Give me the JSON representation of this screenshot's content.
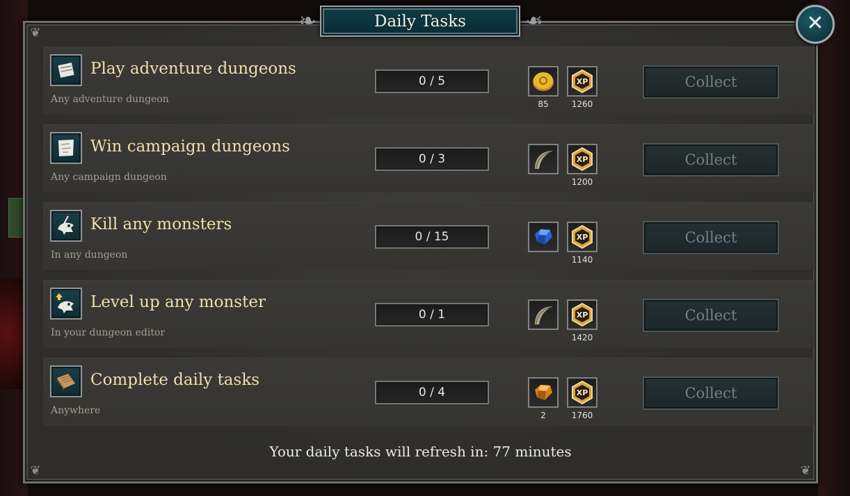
{
  "window": {
    "title": "Daily Tasks"
  },
  "tasks": [
    {
      "title": "Play adventure dungeons",
      "subtitle": "Any adventure dungeon",
      "progress": "0 / 5",
      "reward1": {
        "icon": "gold-coin-icon",
        "amount": "85"
      },
      "reward2": {
        "icon": "xp-icon",
        "amount": "1260"
      },
      "collect_label": "Collect"
    },
    {
      "title": "Win campaign dungeons",
      "subtitle": "Any campaign dungeon",
      "progress": "0 / 3",
      "reward1": {
        "icon": "horn-icon",
        "amount": ""
      },
      "reward2": {
        "icon": "xp-icon",
        "amount": "1200"
      },
      "collect_label": "Collect"
    },
    {
      "title": "Kill any monsters",
      "subtitle": "In any dungeon",
      "progress": "0 / 15",
      "reward1": {
        "icon": "blue-gem-icon",
        "amount": ""
      },
      "reward2": {
        "icon": "xp-icon",
        "amount": "1140"
      },
      "collect_label": "Collect"
    },
    {
      "title": "Level up any monster",
      "subtitle": "In your dungeon editor",
      "progress": "0 / 1",
      "reward1": {
        "icon": "horn-icon",
        "amount": ""
      },
      "reward2": {
        "icon": "xp-icon",
        "amount": "1420"
      },
      "collect_label": "Collect"
    },
    {
      "title": "Complete daily tasks",
      "subtitle": "Anywhere",
      "progress": "0 / 4",
      "reward1": {
        "icon": "orange-gem-icon",
        "amount": "2"
      },
      "reward2": {
        "icon": "xp-icon",
        "amount": "1760"
      },
      "collect_label": "Collect"
    }
  ],
  "footer": {
    "refresh_text": "Your daily tasks will refresh in: 77 minutes"
  },
  "xp_label": "XP",
  "close_glyph": "✕",
  "colors": {
    "title_text": "#efdfae",
    "accent_teal": "#0f3c47",
    "gold": "#e0a82a"
  }
}
